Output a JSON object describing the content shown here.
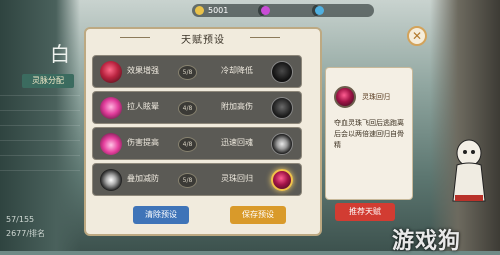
{
  "topbar": {
    "resource_1": "5001",
    "resource_2": "",
    "resource_3": ""
  },
  "side": {
    "header": "灵脉分配",
    "big_char": "白",
    "tabs": [
      "",
      "",
      "",
      "",
      "",
      "",
      "",
      "",
      ""
    ],
    "bottom_1": "57/155",
    "bottom_2": "2677/排名"
  },
  "panel": {
    "title": "天赋预设",
    "rows": [
      {
        "left_label": "效果增强",
        "right_label": "冷却降低",
        "level": "5/8"
      },
      {
        "left_label": "拉人眩晕",
        "right_label": "附加高伤",
        "level": "4/8"
      },
      {
        "left_label": "伤害提高",
        "right_label": "迅速回魂",
        "level": "4/8"
      },
      {
        "left_label": "叠加减防",
        "right_label": "灵珠回归",
        "level": "5/8"
      }
    ],
    "clear_button": "清除预设",
    "save_button": "保存预设"
  },
  "info": {
    "name": "灵珠回归",
    "description": "夺血灵珠飞回后逃跑离后会以两倍速回归自骨精",
    "recommend_button": "推荐天赋"
  },
  "watermark": "游戏狗",
  "colors": {
    "panel_bg": "#f1ebdd",
    "row_bg": "#5b5a55",
    "clear_btn": "#3f74b8",
    "save_btn": "#d99a2a",
    "recommend_btn": "#d23c32"
  }
}
